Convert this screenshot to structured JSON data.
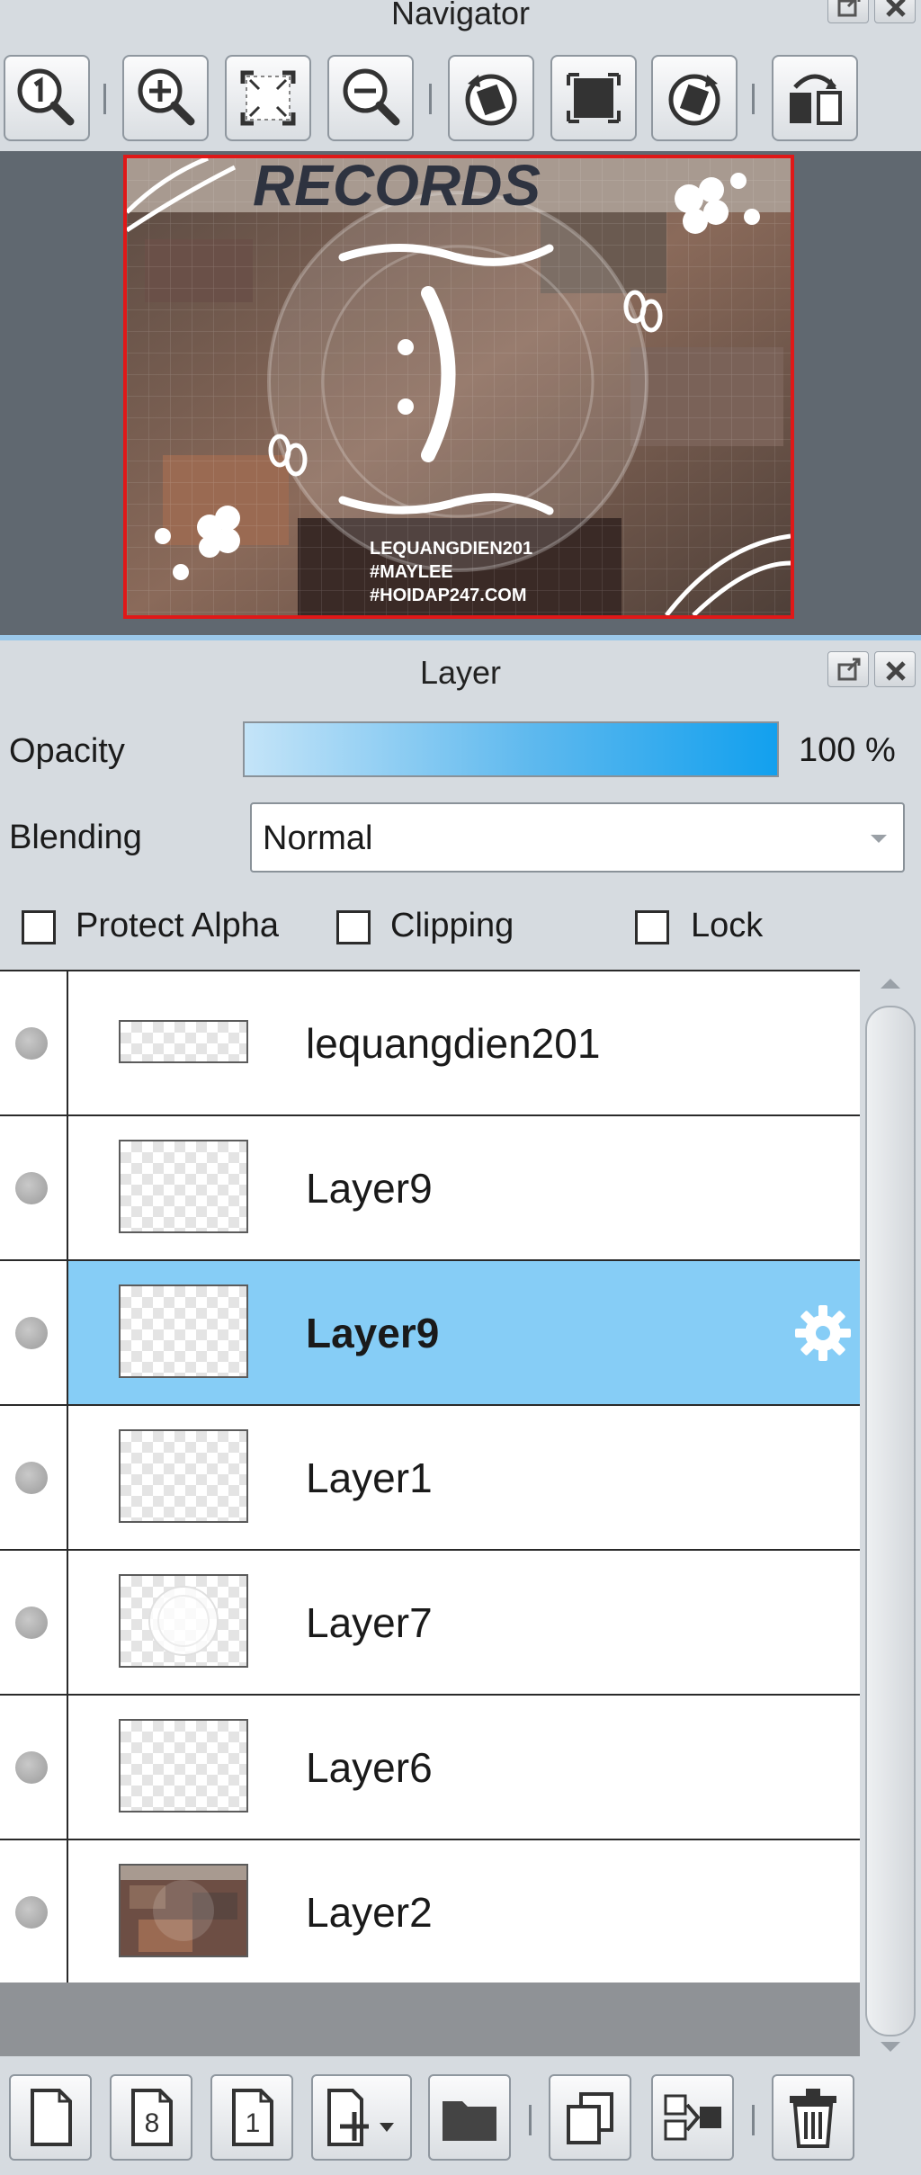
{
  "navigator": {
    "title": "Navigator",
    "toolbar": [
      {
        "name": "zoom-actual-size-button",
        "icon": "zoom-1-icon"
      },
      {
        "name": "zoom-in-button",
        "icon": "zoom-in-icon"
      },
      {
        "name": "fit-to-window-button",
        "icon": "fit-window-icon"
      },
      {
        "name": "zoom-out-button",
        "icon": "zoom-out-icon"
      },
      {
        "name": "rotate-left-button",
        "icon": "rotate-left-icon"
      },
      {
        "name": "reset-rotation-button",
        "icon": "reset-view-icon"
      },
      {
        "name": "rotate-right-button",
        "icon": "rotate-right-icon"
      },
      {
        "name": "flip-horizontal-button",
        "icon": "flip-horizontal-icon"
      }
    ],
    "preview": {
      "header_text": "RECORDS",
      "caption": [
        "LEQUANGDIEN201",
        "#MAYLEE",
        "#HOIDAP247.COM"
      ]
    }
  },
  "layer_panel": {
    "title": "Layer",
    "opacity_label": "Opacity",
    "opacity_value": "100 %",
    "opacity_fraction": 1.0,
    "blending_label": "Blending",
    "blending_value": "Normal",
    "checkboxes": {
      "protect_alpha": {
        "label": "Protect Alpha",
        "checked": false
      },
      "clipping": {
        "label": "Clipping",
        "checked": false
      },
      "lock": {
        "label": "Lock",
        "checked": false
      }
    },
    "layers": [
      {
        "name": "lequangdien201",
        "selected": false,
        "thumb": "text"
      },
      {
        "name": "Layer9",
        "selected": false,
        "thumb": "transparent"
      },
      {
        "name": "Layer9",
        "selected": true,
        "thumb": "transparent"
      },
      {
        "name": "Layer1",
        "selected": false,
        "thumb": "transparent"
      },
      {
        "name": "Layer7",
        "selected": false,
        "thumb": "circle"
      },
      {
        "name": "Layer6",
        "selected": false,
        "thumb": "transparent"
      },
      {
        "name": "Layer2",
        "selected": false,
        "thumb": "photo"
      }
    ]
  },
  "bottom_toolbar": [
    {
      "name": "new-layer-button",
      "icon": "new-layer-icon"
    },
    {
      "name": "new-8bit-layer-button",
      "icon": "new-8bit-layer-icon",
      "text": "8"
    },
    {
      "name": "new-1bit-layer-button",
      "icon": "new-1bit-layer-icon",
      "text": "1"
    },
    {
      "name": "add-layer-menu-button",
      "icon": "add-layer-dropdown-icon"
    },
    {
      "name": "new-folder-button",
      "icon": "folder-icon"
    },
    {
      "name": "duplicate-layer-button",
      "icon": "duplicate-icon"
    },
    {
      "name": "merge-down-button",
      "icon": "merge-down-icon"
    },
    {
      "name": "delete-layer-button",
      "icon": "trash-icon"
    }
  ],
  "colors": {
    "selection": "#86cdf6",
    "navigator_frame": "#e01818",
    "opacity_bar_end": "#12a0ee"
  }
}
